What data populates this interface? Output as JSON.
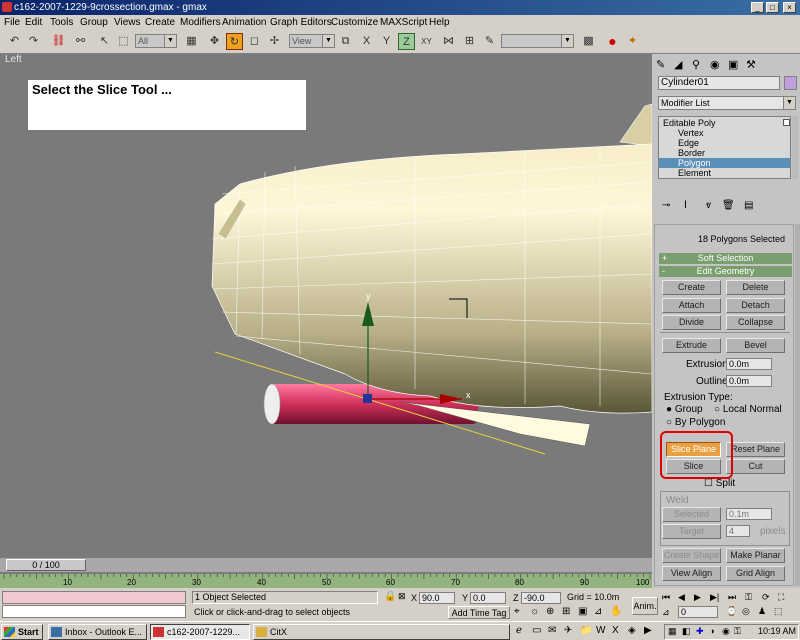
{
  "window": {
    "title": "c162-2007-1229-9crossection.gmax - gmax",
    "min": "_",
    "max": "□",
    "close": "×"
  },
  "menu": [
    "File",
    "Edit",
    "Tools",
    "Group",
    "Views",
    "Create",
    "Modifiers",
    "Animation",
    "Graph Editors",
    "Customize",
    "MAXScript",
    "Help"
  ],
  "toolbar": {
    "filter_value": "All",
    "coord_value": "View",
    "named_selection": ""
  },
  "viewport": {
    "label": "Left",
    "instruction": "Select the Slice Tool ...",
    "axis_x": "x",
    "axis_y": "y"
  },
  "panel": {
    "object_name": "Cylinder01",
    "modifier_list": "Modifier List",
    "stack": [
      {
        "label": "Editable Poly",
        "level": 0
      },
      {
        "label": "Vertex",
        "level": 1
      },
      {
        "label": "Edge",
        "level": 1
      },
      {
        "label": "Border",
        "level": 1
      },
      {
        "label": "Polygon",
        "level": 1,
        "selected": true
      },
      {
        "label": "Element",
        "level": 1
      }
    ],
    "selection_info": "18 Polygons Selected",
    "rollout_soft": "Soft Selection",
    "rollout_soft_sign": "+",
    "rollout_edit": "Edit Geometry",
    "rollout_edit_sign": "-",
    "btn_create": "Create",
    "btn_delete": "Delete",
    "btn_attach": "Attach",
    "btn_detach": "Detach",
    "btn_divide": "Divide",
    "btn_collapse": "Collapse",
    "btn_extrude": "Extrude",
    "btn_bevel": "Bevel",
    "extrusion_label": "Extrusion:",
    "extrusion_value": "0.0m",
    "outline_label": "Outline",
    "outline_value": "0.0m",
    "extrusion_type": "Extrusion Type:",
    "radio_group": "Group",
    "radio_local": "Local Normal",
    "radio_poly": "By Polygon",
    "btn_slice_plane": "Slice Plane",
    "btn_reset_plane": "Reset Plane",
    "btn_slice": "Slice",
    "btn_cut": "Cut",
    "split_label": "Split",
    "weld_label": "Weld",
    "weld_selected": "Selected",
    "weld_selected_value": "0.1m",
    "weld_target": "Target",
    "weld_target_value": "4",
    "weld_pixels": "pixels",
    "btn_create_shape": "Create Shape",
    "btn_make_planar": "Make Planar",
    "btn_view_align": "View Align",
    "btn_grid_align": "Grid Align",
    "highlight_color": "#e00000",
    "active_color": "#e8a040"
  },
  "time": {
    "slider_label": "0 / 100",
    "ticks": [
      "10",
      "20",
      "30",
      "40",
      "50",
      "60",
      "70",
      "80",
      "90",
      "100"
    ]
  },
  "status": {
    "selected": "1 Object Selected",
    "prompt": "Click or click-and-drag to select objects",
    "x_label": "X",
    "x_value": "90.0",
    "y_label": "Y",
    "y_value": "0.0",
    "z_label": "Z",
    "z_value": "-90.0",
    "grid": "Grid = 10.0m",
    "add_time_tag": "Add Time Tag",
    "anim": "Anim.",
    "frame": "0"
  },
  "taskbar": {
    "start": "Start",
    "tasks": [
      {
        "label": "Inbox - Outlook E...",
        "active": false
      },
      {
        "label": "c162-2007-1229...",
        "active": true
      },
      {
        "label": "CitX",
        "active": false
      }
    ],
    "clock": "10:19 AM"
  }
}
